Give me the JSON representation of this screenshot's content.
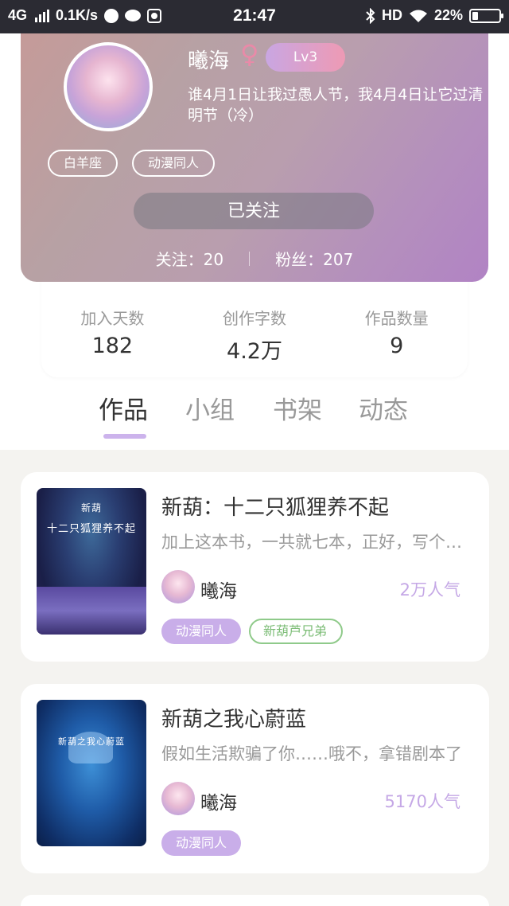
{
  "status_bar": {
    "network": "4G",
    "speed": "0.1K/s",
    "time": "21:47",
    "hd": "HD",
    "battery": "22%",
    "battery_level": 0.22
  },
  "profile": {
    "nickname": "曦海",
    "gender_symbol": "♀",
    "level": "Lv3",
    "bio": "谁4月1日让我过愚人节，我4月4日让它过清明节（冷）",
    "tags": [
      "白羊座",
      "动漫同人"
    ],
    "follow_button": "已关注",
    "following": "关注：20",
    "followers": "粉丝：207"
  },
  "stats": [
    {
      "label": "加入天数",
      "value": "182"
    },
    {
      "label": "创作字数",
      "value": "4.2万"
    },
    {
      "label": "作品数量",
      "value": "9"
    }
  ],
  "tabs": [
    "作品",
    "小组",
    "书架",
    "动态"
  ],
  "works": [
    {
      "cover_text_top": "新葫",
      "cover_text_main": "十二只狐狸养不起",
      "title": "新葫：十二只狐狸养不起",
      "desc": "加上这本书，一共就七本，正好，写个七个葫芦娃",
      "author": "曦海",
      "popularity": "2万人气",
      "tags": [
        "动漫同人"
      ],
      "tags_green": [
        "新葫芦兄弟"
      ]
    },
    {
      "cover_text_top": "",
      "cover_text_main": "新葫之我心蔚蓝",
      "title": "新葫之我心蔚蓝",
      "desc": "假如生活欺骗了你……哦不，拿错剧本了",
      "author": "曦海",
      "popularity": "5170人气",
      "tags": [
        "动漫同人"
      ],
      "tags_green": []
    }
  ],
  "colors": {
    "accent_purple": "#c9aee9",
    "popularity_purple": "#c5a8e6",
    "green_tag": "#7dbd77",
    "gender_pink": "#e98aa8"
  }
}
